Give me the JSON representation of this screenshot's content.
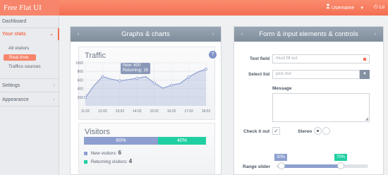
{
  "header": {
    "brand": "Free Flat UI",
    "user_name": "Username",
    "logout_label": "Lo"
  },
  "sidebar": {
    "items": [
      {
        "label": "Dashboard"
      },
      {
        "label": "Your stats"
      },
      {
        "label": "Settings"
      },
      {
        "label": "Appearance"
      }
    ],
    "subitems": [
      {
        "label": "All visitors"
      },
      {
        "label": "Real time"
      },
      {
        "label": "Traffics sources"
      }
    ]
  },
  "left_panel": {
    "title": "Graphs & charts",
    "traffic": {
      "title": "Traffic",
      "help": "?",
      "tooltip_new": "New: 600",
      "tooltip_returning": "Returning: 18"
    },
    "visitors": {
      "title": "Visitors",
      "pct_new_label": "60%",
      "pct_returning_label": "40%",
      "new_label": "New visitors:",
      "new_value": "6",
      "returning_label": "Returning visitors:",
      "returning_value": "4"
    }
  },
  "right_panel": {
    "title": "Form & input elements & controls",
    "text_field_label": "Text field",
    "text_field_placeholder": "must fill out",
    "select_label": "Select list",
    "select_value": "pick me!",
    "message_label": "Message",
    "check_label": "Check it out",
    "stereo_label": "Stereo",
    "range_label": "Range slider",
    "range_low": "30%",
    "range_high": "70%"
  },
  "colors": {
    "accent": "#f46f53",
    "blue": "#8d9fcf",
    "green": "#1fcfa2",
    "panel_header": "#8592a3"
  },
  "chart_data": {
    "type": "area",
    "title": "Traffic",
    "categories": [
      "11:02",
      "12:02",
      "13:02",
      "14:02",
      "15:02",
      "16:02",
      "17:02",
      "18:02"
    ],
    "x": [
      0,
      1,
      2,
      3,
      4,
      5,
      6,
      7,
      8,
      9,
      10,
      11,
      12,
      13,
      14
    ],
    "values": [
      195,
      470,
      680,
      620,
      585,
      610,
      640,
      680,
      530,
      410,
      480,
      520,
      670,
      780,
      855
    ],
    "yticks": [
      200,
      400,
      600,
      800,
      1000
    ],
    "ylim": [
      0,
      1000
    ],
    "grid": true
  }
}
